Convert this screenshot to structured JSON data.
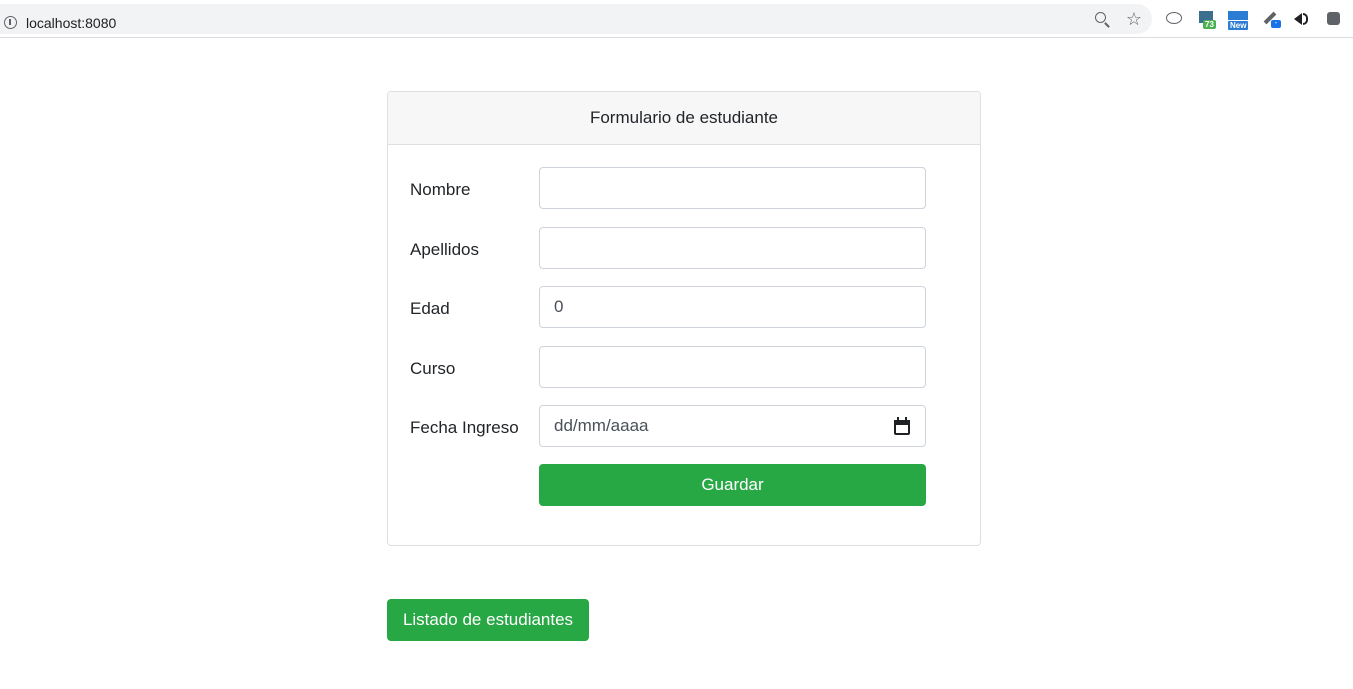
{
  "browser": {
    "url": "localhost:8080",
    "extension_badges": {
      "ext2": "73",
      "ext3": "New",
      "ext4": "-"
    }
  },
  "form": {
    "title": "Formulario de estudiante",
    "fields": [
      {
        "label": "Nombre",
        "value": "",
        "placeholder": ""
      },
      {
        "label": "Apellidos",
        "value": "",
        "placeholder": ""
      },
      {
        "label": "Edad",
        "value": "0",
        "placeholder": ""
      },
      {
        "label": "Curso",
        "value": "",
        "placeholder": ""
      },
      {
        "label": "Fecha Ingreso",
        "value": "dd/mm/aaaa",
        "placeholder": ""
      }
    ],
    "save_label": "Guardar"
  },
  "actions": {
    "list_label": "Listado de estudiantes"
  },
  "colors": {
    "success": "#28a745",
    "header_bg": "#f7f7f7",
    "border": "#dfdfdf"
  }
}
